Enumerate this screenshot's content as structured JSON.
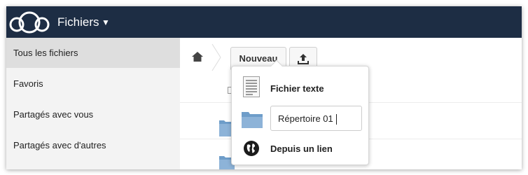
{
  "header": {
    "title": "Fichiers",
    "caret": "▼"
  },
  "sidebar": {
    "items": [
      {
        "label": "Tous les fichiers",
        "active": true
      },
      {
        "label": "Favoris",
        "active": false
      },
      {
        "label": "Partagés avec vous",
        "active": false
      },
      {
        "label": "Partagés avec d'autres",
        "active": false
      }
    ]
  },
  "toolbar": {
    "new_label": "Nouveau",
    "upload_icon": "upload-icon"
  },
  "new_menu": {
    "text_file_label": "Fichier texte",
    "folder_input_value": "Répertoire 01",
    "link_label": "Depuis un lien"
  },
  "colors": {
    "header_bg": "#1d2d44",
    "sidebar_bg": "#f3f3f3",
    "sidebar_active": "#dedede"
  }
}
